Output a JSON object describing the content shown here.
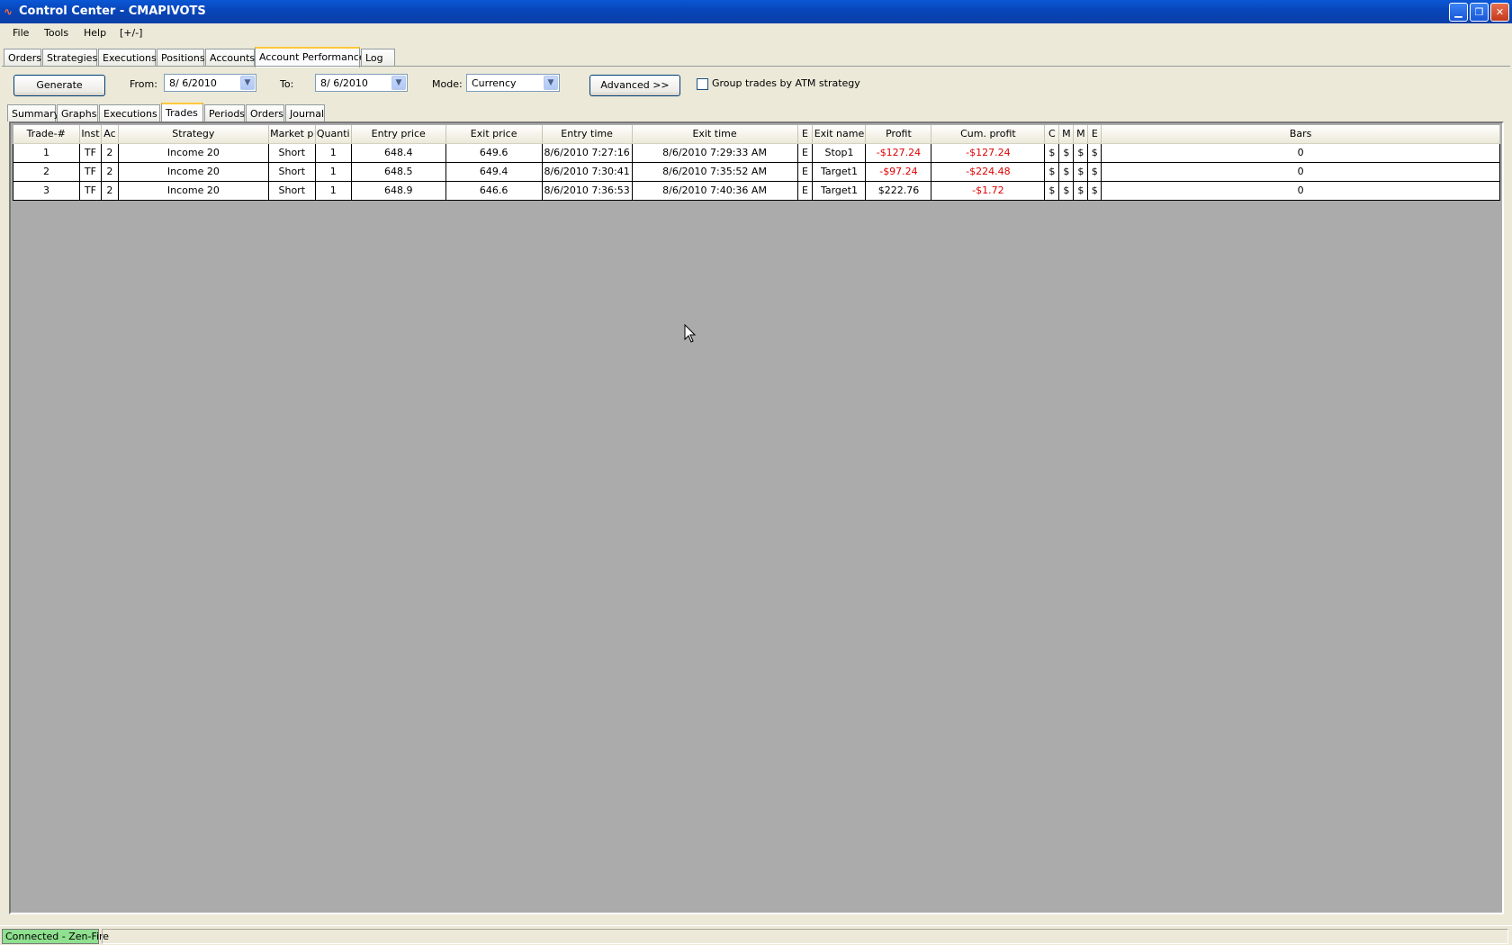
{
  "window": {
    "title": "Control Center - CMAPIVOTS"
  },
  "menu": [
    "File",
    "Tools",
    "Help",
    "[+/-]"
  ],
  "top_tabs": [
    "Orders",
    "Strategies",
    "Executions",
    "Positions",
    "Accounts",
    "Account Performance",
    "Log"
  ],
  "toolbar": {
    "generate_label": "Generate",
    "from_label": "From:",
    "from_value": "8/  6/2010",
    "to_label": "To:",
    "to_value": "8/  6/2010",
    "mode_label": "Mode:",
    "mode_value": "Currency",
    "advanced_label": "Advanced >>",
    "group_trades_label": "Group trades by ATM strategy",
    "group_trades_checked": false
  },
  "sub_tabs": [
    "Summary",
    "Graphs",
    "Executions",
    "Trades",
    "Periods",
    "Orders",
    "Journal"
  ],
  "grid": {
    "columns": [
      "Trade-#",
      "Inst",
      "Ac",
      "Strategy",
      "Market p",
      "Quanti",
      "Entry price",
      "Exit price",
      "Entry time",
      "Exit time",
      "E",
      "Exit name",
      "Profit",
      "Cum. profit",
      "C",
      "M",
      "M",
      "E",
      "Bars"
    ],
    "rows": [
      [
        "1",
        "TF",
        "2",
        "Income 20",
        "Short",
        "1",
        "648.4",
        "649.6",
        "8/6/2010 7:27:16",
        "8/6/2010 7:29:33 AM",
        "E",
        "Stop1",
        "-$127.24",
        "-$127.24",
        "$",
        "$",
        "$",
        "$",
        "0"
      ],
      [
        "2",
        "TF",
        "2",
        "Income 20",
        "Short",
        "1",
        "648.5",
        "649.4",
        "8/6/2010 7:30:41",
        "8/6/2010 7:35:52 AM",
        "E",
        "Target1",
        "-$97.24",
        "-$224.48",
        "$",
        "$",
        "$",
        "$",
        "0"
      ],
      [
        "3",
        "TF",
        "2",
        "Income 20",
        "Short",
        "1",
        "648.9",
        "646.6",
        "8/6/2010 7:36:53",
        "8/6/2010 7:40:36 AM",
        "E",
        "Target1",
        "$222.76",
        "-$1.72",
        "$",
        "$",
        "$",
        "$",
        "0"
      ]
    ],
    "negative_color": "#e00000"
  },
  "status": {
    "connection": "Connected - Zen-Fire",
    "connection_color": "#8fe08f"
  }
}
